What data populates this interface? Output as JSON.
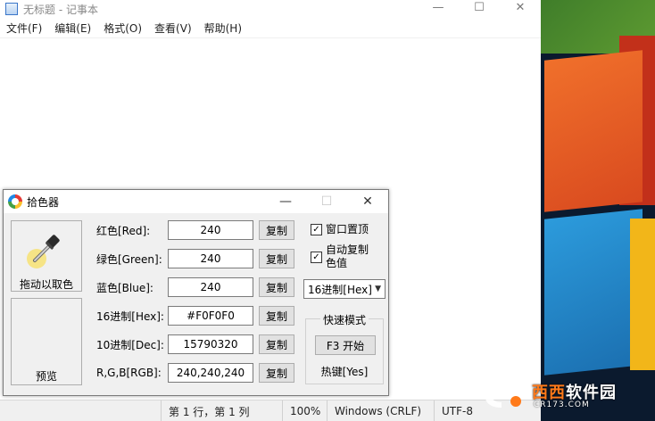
{
  "notepad": {
    "title": "无标题 - 记事本",
    "menu": [
      "文件(F)",
      "编辑(E)",
      "格式(O)",
      "查看(V)",
      "帮助(H)"
    ],
    "status": {
      "position": "第 1 行，第 1 列",
      "zoom": "100%",
      "line_ending": "Windows (CRLF)",
      "encoding": "UTF-8"
    }
  },
  "window_controls": {
    "minimize": "—",
    "maximize": "☐",
    "close": "✕"
  },
  "picker": {
    "title": "拾色器",
    "drag_label": "拖动以取色",
    "preview_label": "预览",
    "rows": [
      {
        "label": "红色[Red]:",
        "value": "240",
        "copy": "复制"
      },
      {
        "label": "绿色[Green]:",
        "value": "240",
        "copy": "复制"
      },
      {
        "label": "蓝色[Blue]:",
        "value": "240",
        "copy": "复制"
      },
      {
        "label": "16进制[Hex]:",
        "value": "#F0F0F0",
        "copy": "复制"
      },
      {
        "label": "10进制[Dec]:",
        "value": "15790320",
        "copy": "复制"
      },
      {
        "label": "R,G,B[RGB]:",
        "value": "240,240,240",
        "copy": "复制"
      }
    ],
    "topmost_label": "窗口置顶",
    "topmost_checked": true,
    "autocopy_label_1": "自动复制",
    "autocopy_label_2": "色值",
    "autocopy_checked": true,
    "format_select": "16进制[Hex]",
    "quick_mode_title": "快速模式",
    "f3_button": "F3 开始",
    "hotkey_label": "热键[Yes]",
    "preview_color": "#F0F0F0"
  },
  "watermark": {
    "name_accent": "西西",
    "name_rest": "软件园",
    "domain": "CR173.COM"
  },
  "icons": {
    "check": "✓",
    "chevron": "▼"
  }
}
